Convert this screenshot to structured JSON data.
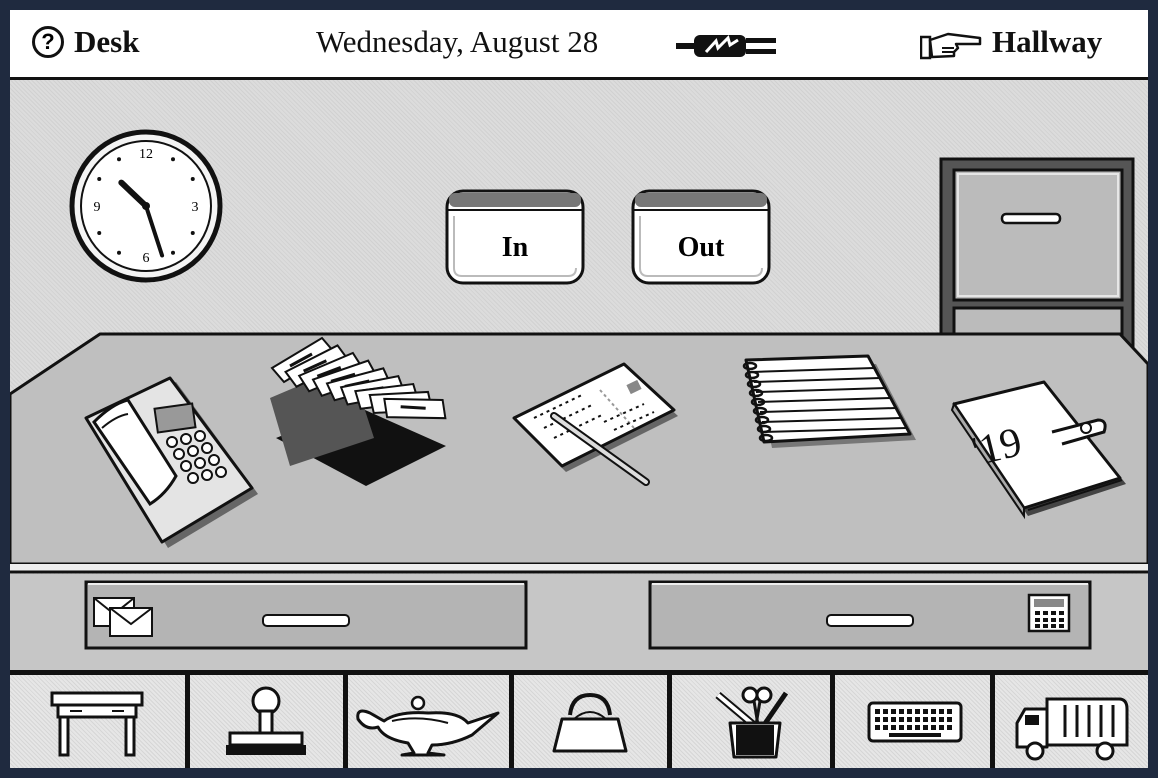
{
  "menubar": {
    "help_symbol": "?",
    "title": "Desk",
    "date": "Wednesday, August 28",
    "destination": "Hallway",
    "icons": [
      "help-icon",
      "power-plug-icon",
      "pointing-hand-icon"
    ]
  },
  "wall": {
    "clock": {
      "hour": 10,
      "minute": 27,
      "numerals": [
        "12",
        "3",
        "6",
        "9"
      ]
    },
    "in_tray_label": "In",
    "out_tray_label": "Out"
  },
  "desktop": {
    "items": [
      "telephone-icon",
      "card-file-icon",
      "postcard-icon",
      "notebook-icon",
      "datebook-icon"
    ],
    "datebook_label": "'19"
  },
  "drawers": {
    "left_icon": "envelopes-icon",
    "right_icon": "calculator-icon"
  },
  "toolbar": {
    "buttons": [
      "desk-icon",
      "stamp-icon",
      "magic-lamp-icon",
      "purse-icon",
      "tools-cup-icon",
      "keyboard-icon",
      "garbage-truck-icon"
    ]
  },
  "colors": {
    "frame": "#1f2a3f",
    "ink": "#111111",
    "wall": "#dcdcdc",
    "desk": "#bfbfbf"
  }
}
